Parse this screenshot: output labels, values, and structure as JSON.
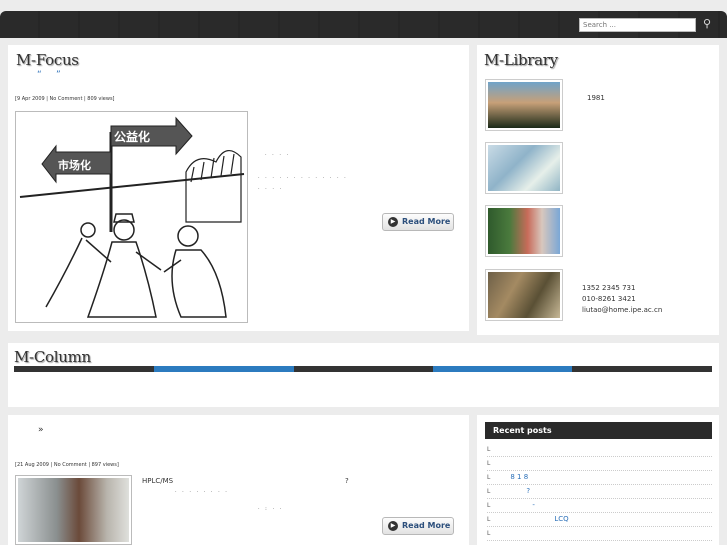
{
  "search": {
    "placeholder": "Search ..."
  },
  "focus": {
    "heading": "M-Focus",
    "quote_open": "“",
    "quote_close": "”",
    "meta": "[9 Apr 2009 | No Comment | 809 views]",
    "image": {
      "sign_upper": "公益化",
      "sign_lower": "市场化"
    },
    "read_more": "Read More"
  },
  "library": {
    "heading": "M-Library",
    "entries": [
      {
        "text": "1981"
      },
      {
        "text": ""
      },
      {
        "text": ""
      },
      {
        "lines": [
          "1352 2345 731",
          "010-8261 3421",
          "liutao@home.ipe.ac.cn"
        ]
      }
    ]
  },
  "column": {
    "heading": "M-Column"
  },
  "posts": {
    "guillemet": "»",
    "meta": "[21 Aug 2009 | No Comment | 897 views]",
    "excerpt_start": "HPLC/MS",
    "excerpt_q": "?",
    "read_more": "Read More"
  },
  "recent": {
    "title": "Recent posts",
    "items": [
      "",
      "",
      "8 1 8",
      "?",
      "-",
      "LCQ",
      ""
    ]
  },
  "colors": {
    "accent_blue": "#2c7bbf",
    "dark": "#2a2a2a"
  }
}
